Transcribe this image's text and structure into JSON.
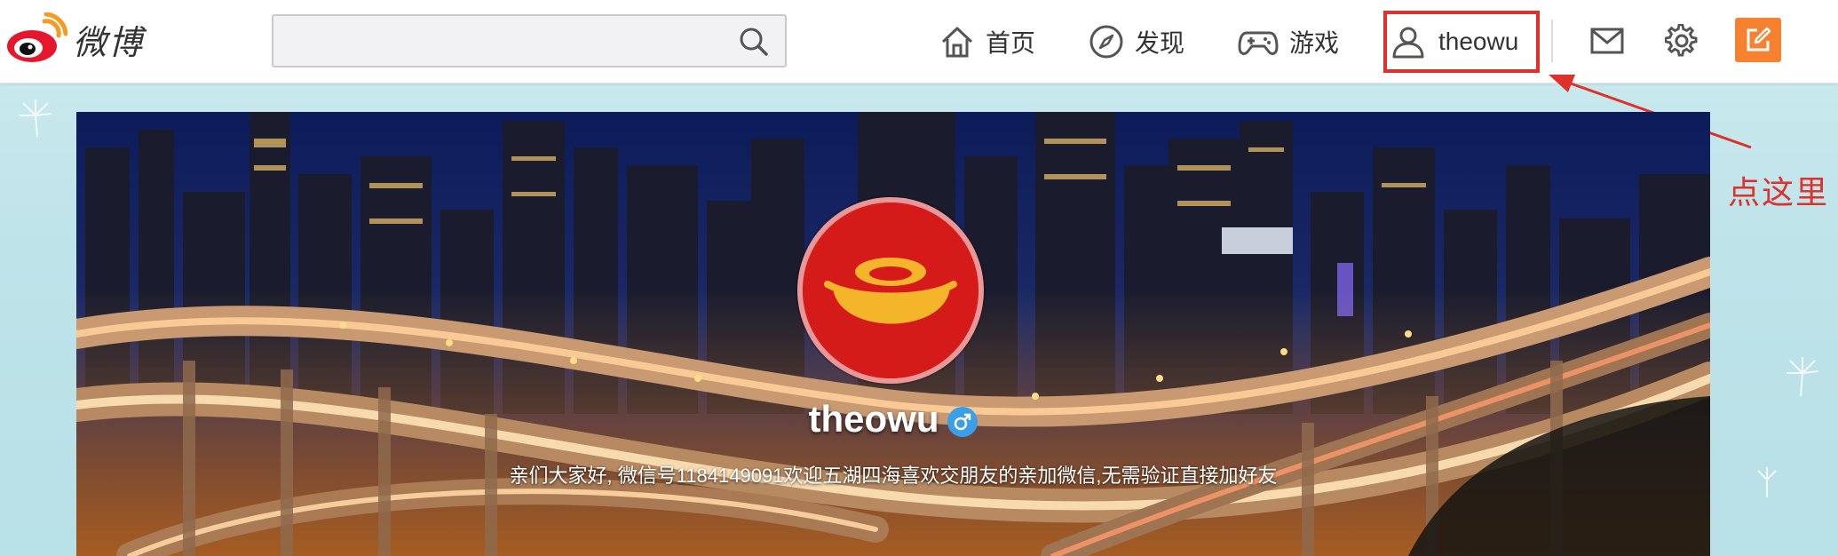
{
  "app": {
    "logo_text": "微博"
  },
  "search": {
    "value": "",
    "placeholder": ""
  },
  "nav": {
    "home_label": "首页",
    "discover_label": "发现",
    "games_label": "游戏",
    "user_label": "theowu"
  },
  "annotation": {
    "text": "点这里",
    "color": "#e0302a"
  },
  "profile": {
    "username": "theowu",
    "gender": "male",
    "bio": "亲们大家好, 微信号1184149091欢迎五湖四海喜欢交朋友的亲加微信,无需验证直接加好友"
  },
  "colors": {
    "accent": "#f6812f",
    "highlight_border": "#e0302a",
    "gender_badge": "#3b9ee8",
    "avatar_bg": "#d51a1a"
  },
  "icons": {
    "search": "search-icon",
    "home": "home-icon",
    "discover": "compass-icon",
    "games": "gamepad-icon",
    "user": "user-icon",
    "mail": "mail-icon",
    "settings": "gear-icon",
    "compose": "compose-icon"
  }
}
